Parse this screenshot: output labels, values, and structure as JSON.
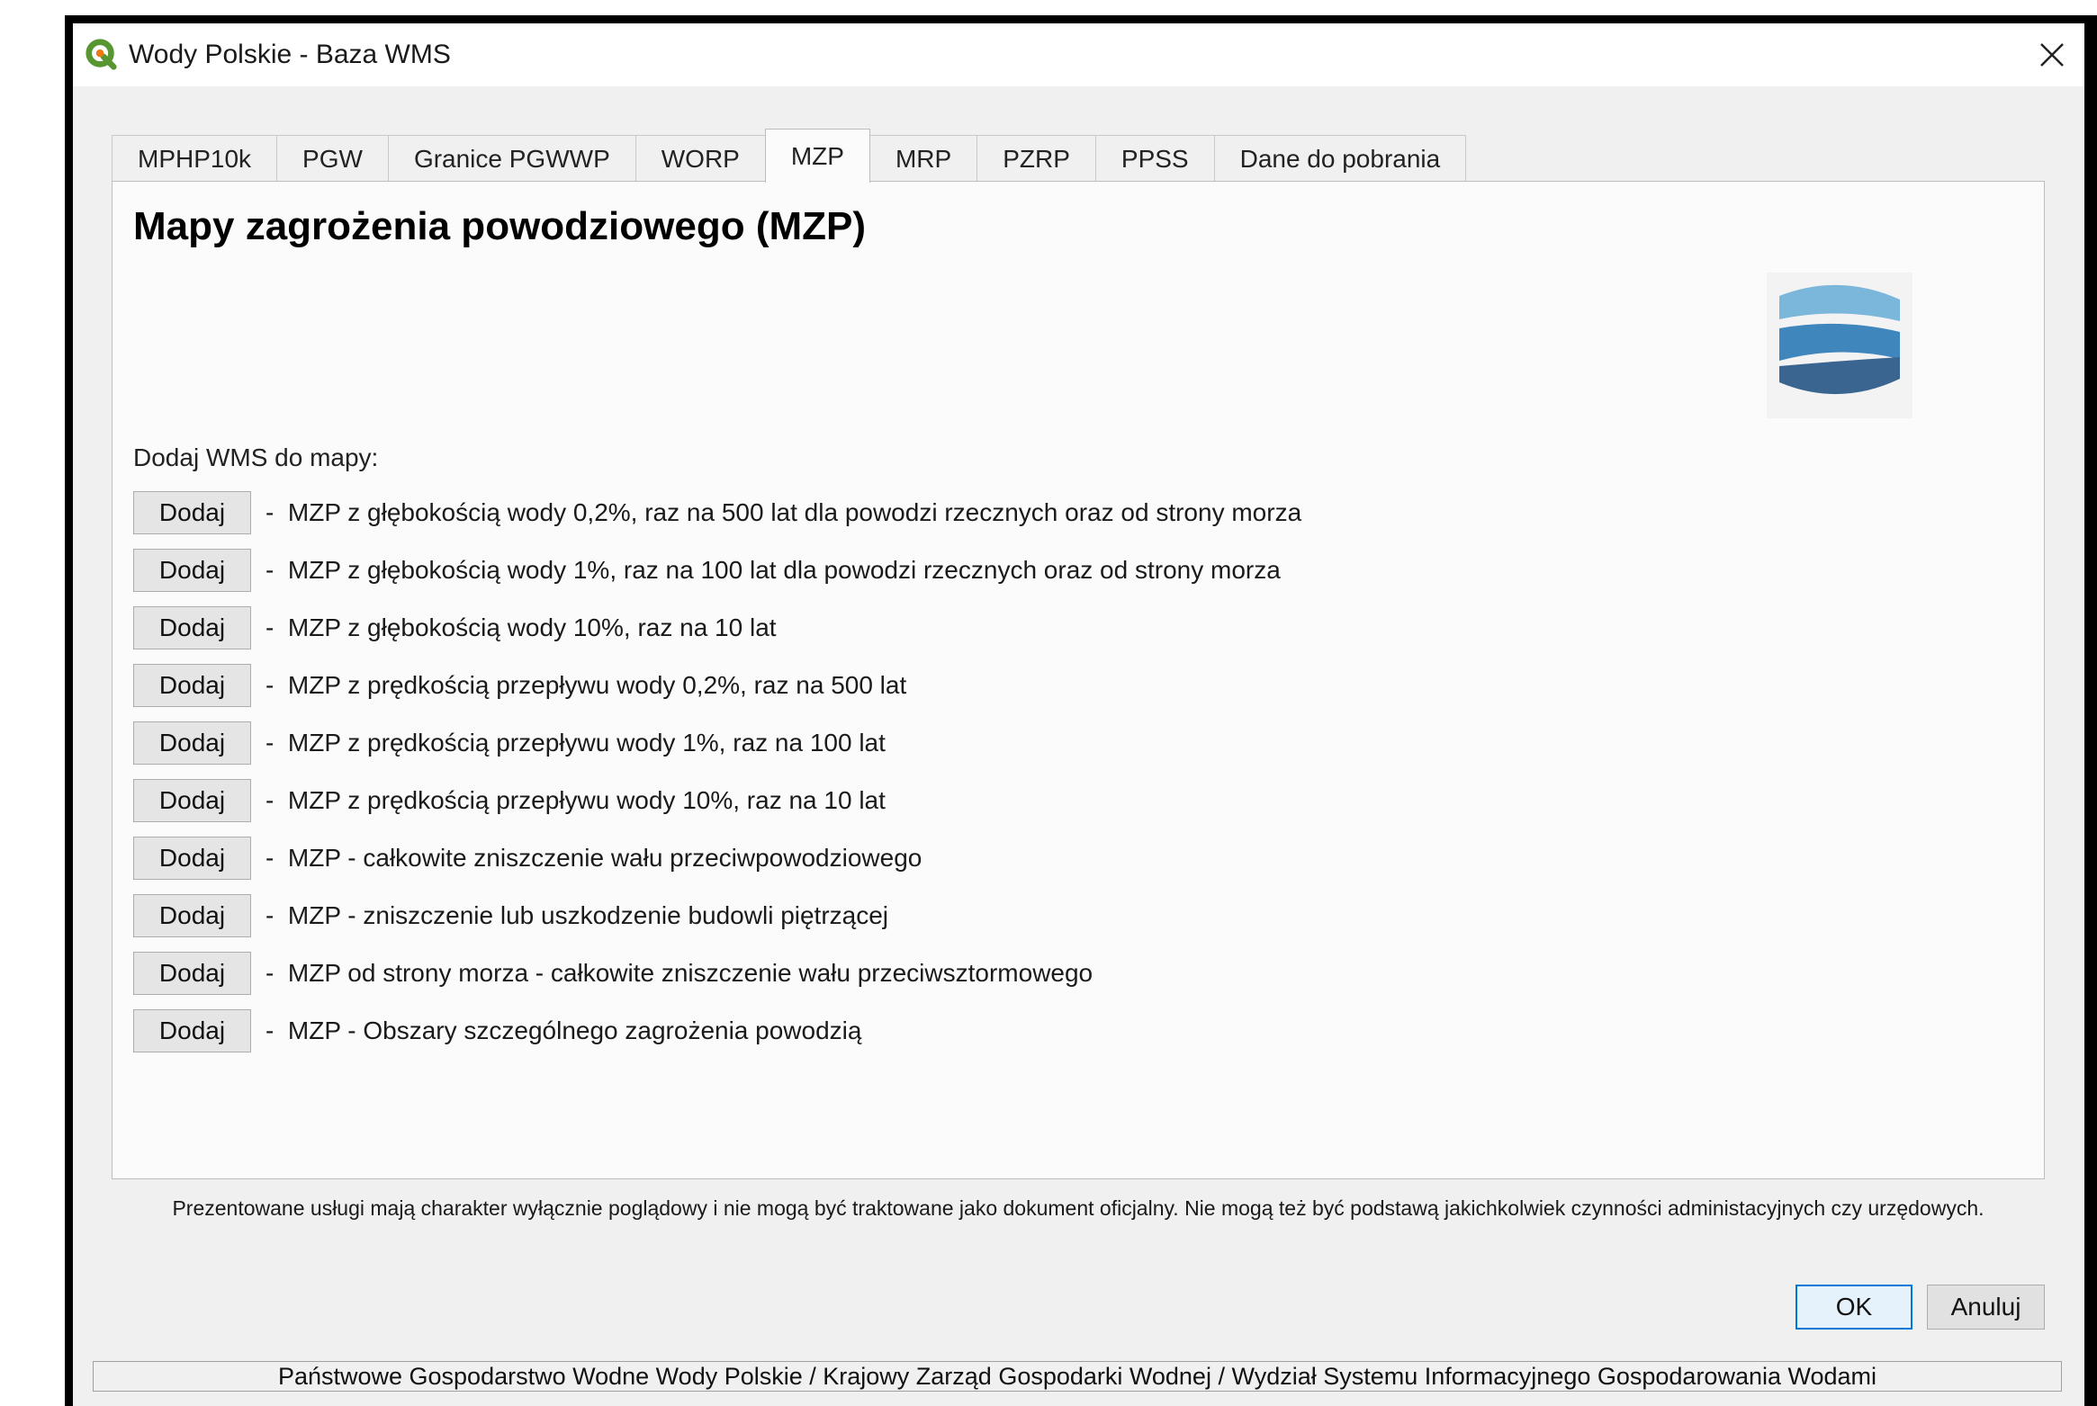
{
  "window": {
    "title": "Wody Polskie - Baza WMS"
  },
  "tabs": [
    {
      "label": "MPHP10k"
    },
    {
      "label": "PGW"
    },
    {
      "label": "Granice PGWWP"
    },
    {
      "label": "WORP"
    },
    {
      "label": "MZP"
    },
    {
      "label": "MRP"
    },
    {
      "label": "PZRP"
    },
    {
      "label": "PPSS"
    },
    {
      "label": "Dane do pobrania"
    }
  ],
  "active_tab": "MZP",
  "panel": {
    "heading": "Mapy zagrożenia powodziowego (MZP)",
    "add_label": "Dodaj WMS do mapy:",
    "button_label": "Dodaj",
    "dash": "-",
    "layers": [
      "MZP z głębokością wody 0,2%, raz na 500 lat dla powodzi rzecznych oraz od strony morza",
      "MZP z głębokością wody 1%, raz na 100 lat dla powodzi rzecznych oraz od strony morza",
      "MZP z głębokością wody 10%, raz na 10 lat",
      "MZP z prędkością przepływu wody 0,2%, raz na 500 lat",
      "MZP z prędkością przepływu wody 1%, raz na 100 lat",
      "MZP z prędkością przepływu wody 10%, raz na 10 lat",
      "MZP - całkowite zniszczenie wału przeciwpowodziowego",
      "MZP - zniszczenie lub uszkodzenie budowli piętrzącej",
      "MZP od strony morza - całkowite zniszczenie wału przeciwsztormowego",
      "MZP - Obszary szczególnego zagrożenia powodzią"
    ]
  },
  "disclaimer": "Prezentowane usługi mają charakter wyłącznie poglądowy i nie mogą być traktowane jako dokument oficjalny. Nie mogą też być podstawą jakichkolwiek czynności administacyjnych czy urzędowych.",
  "buttons": {
    "ok": "OK",
    "cancel": "Anuluj"
  },
  "footer": "Państwowe Gospodarstwo Wodne Wody Polskie / Krajowy Zarząd Gospodarki Wodnej / Wydział Systemu Informacyjnego Gospodarowania Wodami",
  "colors": {
    "logo_light": "#7bb6db",
    "logo_mid": "#3f86bd",
    "logo_dark": "#3a6591",
    "accent": "#0078d7"
  },
  "icons": {
    "app": "qgis-icon",
    "close": "close-icon",
    "logo": "wody-polskie-logo"
  }
}
